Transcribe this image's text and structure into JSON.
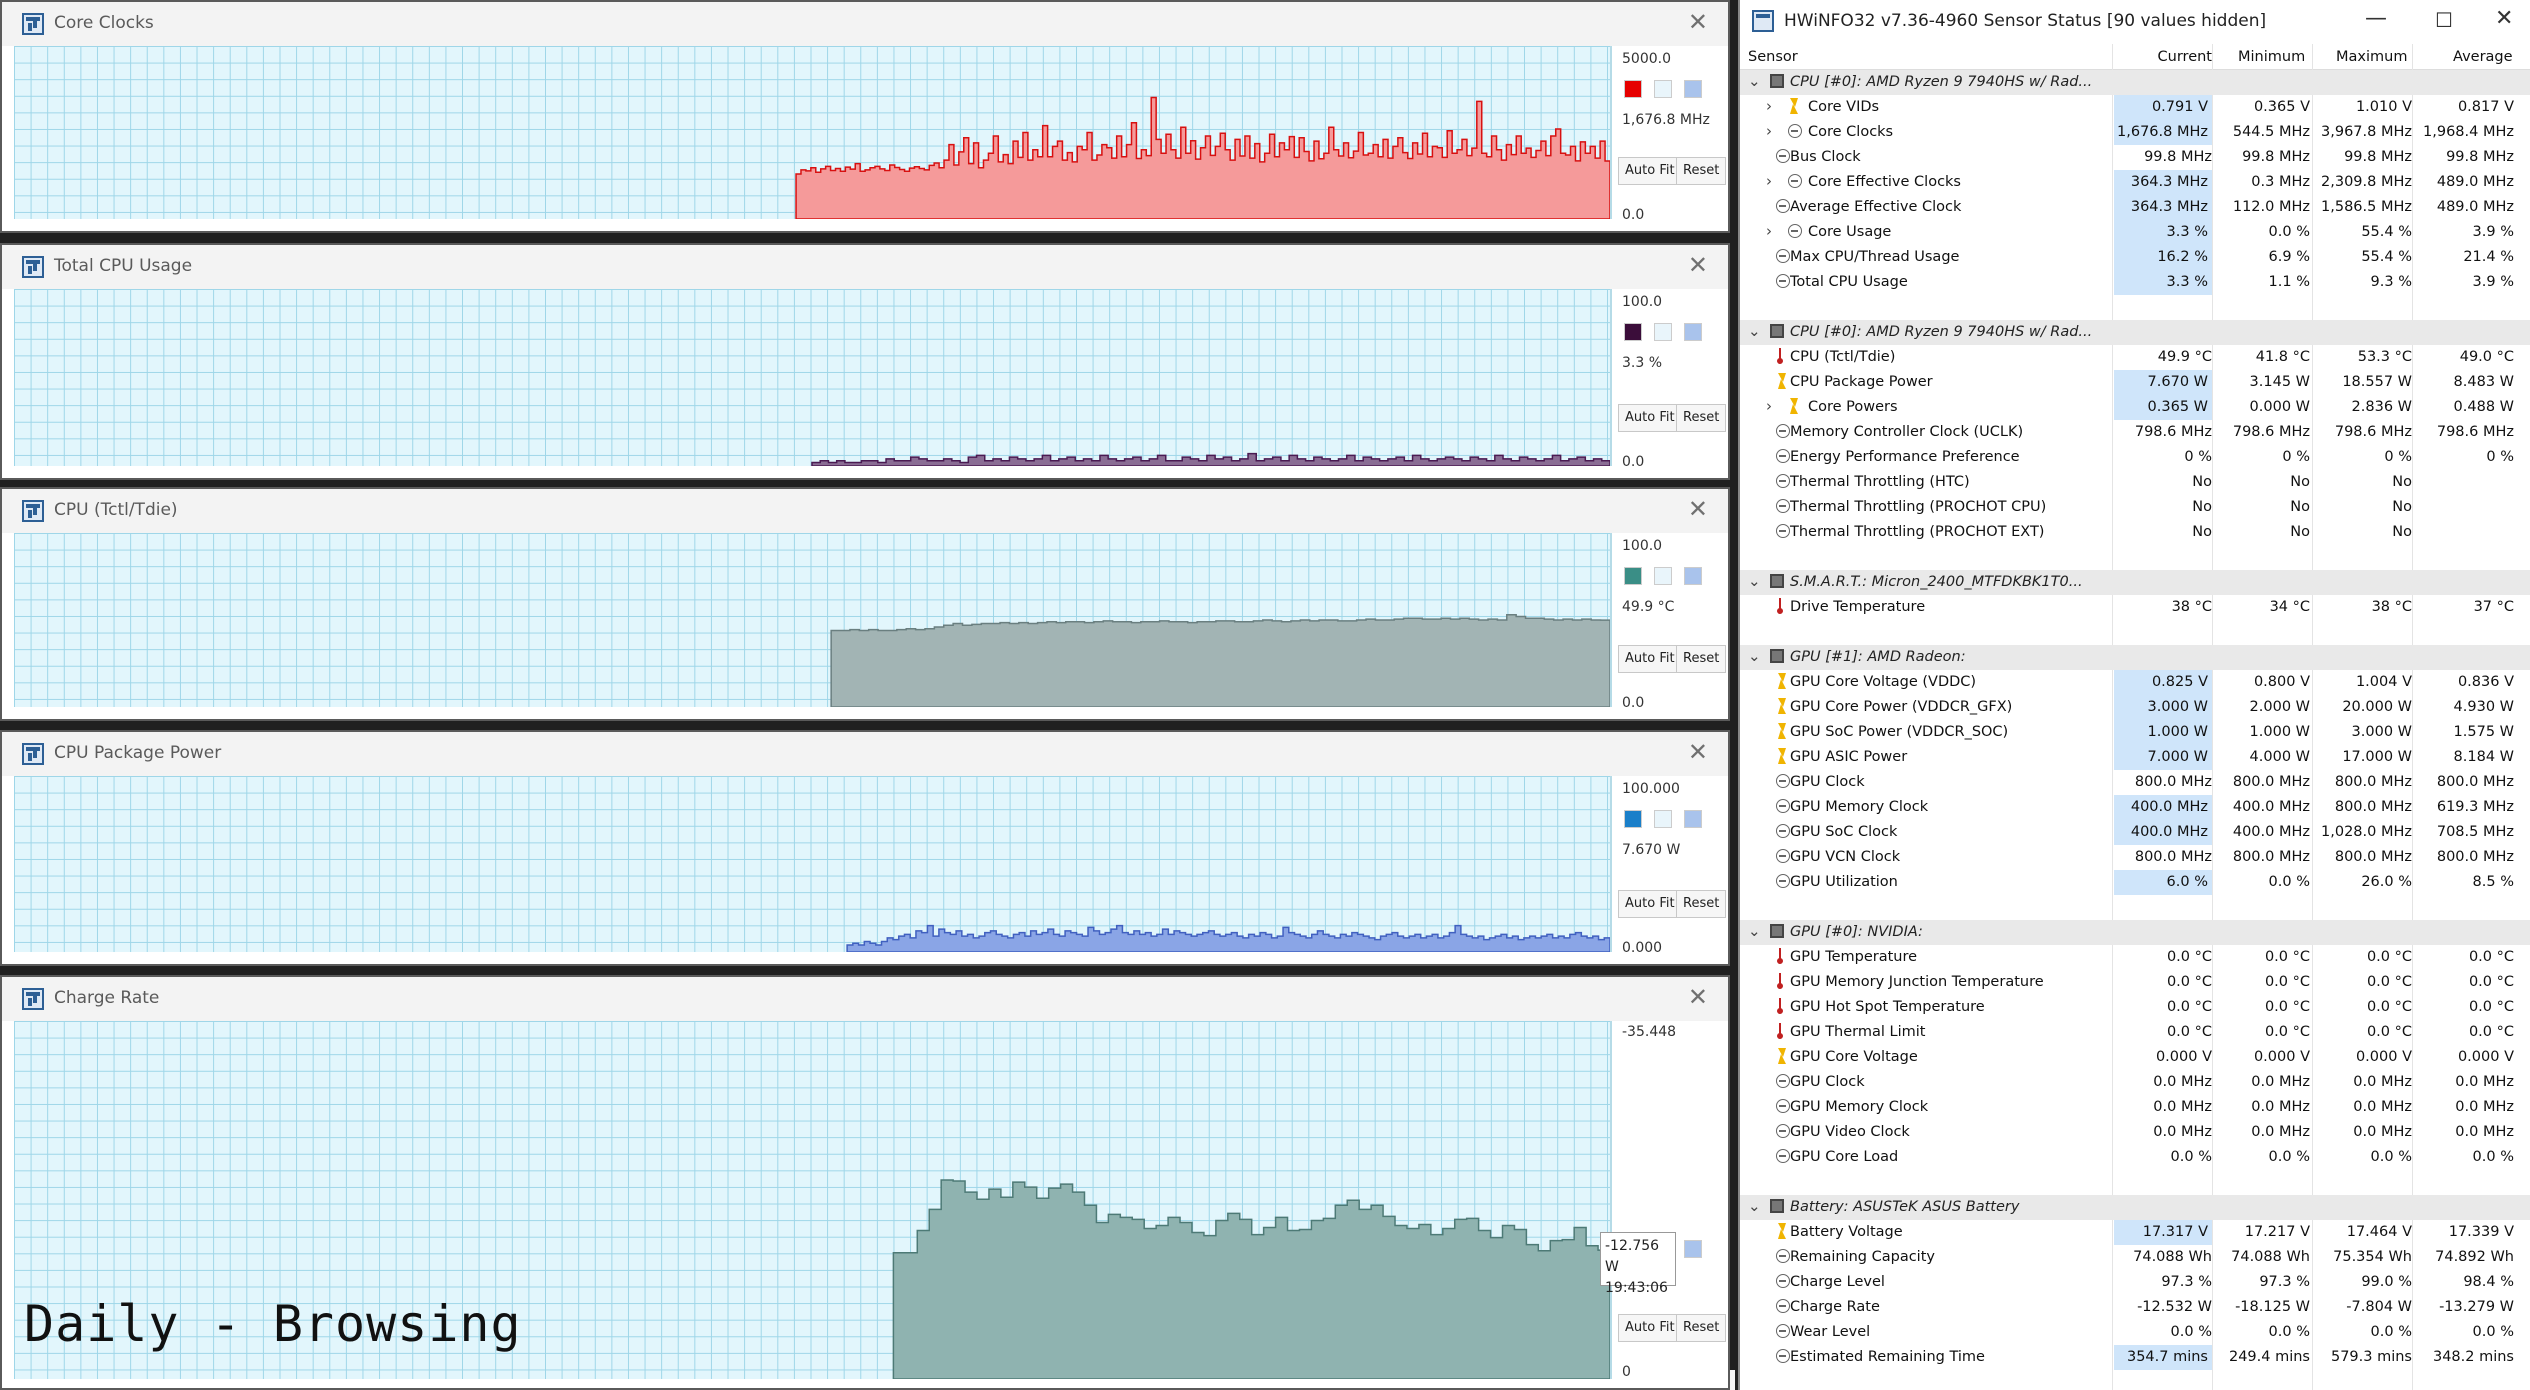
{
  "graphs": [
    {
      "title": "Core Clocks",
      "max": "5000.0",
      "min": "0.0",
      "current": "1,676.8 MHz",
      "color": "#e60000",
      "fill": "#f59a9a",
      "stroke": "#d81010",
      "series_max": 5000,
      "series": [
        1300,
        1420,
        1390,
        1480,
        1350,
        1450,
        1520,
        1400,
        1460,
        1380,
        1500,
        1440,
        1600,
        1380,
        1420,
        1480,
        1520,
        1450,
        1400,
        1560,
        1490,
        1430,
        1380,
        1470,
        1510,
        1460,
        1420,
        1550,
        1620,
        1480,
        1700,
        2150,
        1560,
        1940,
        2350,
        1600,
        2200,
        1480,
        1700,
        1900,
        2400,
        1650,
        1860,
        1600,
        2250,
        1780,
        2500,
        1700,
        2000,
        1800,
        2700,
        1800,
        2100,
        2250,
        1700,
        1920,
        1650,
        2100,
        2000,
        2500,
        1700,
        1850,
        2150,
        2060,
        1760,
        2400,
        1800,
        2150,
        2780,
        1750,
        2000,
        1830,
        3510,
        2300,
        1900,
        2450,
        2000,
        1760,
        2650,
        1900,
        2260,
        1730,
        2060,
        2400,
        1840,
        2100,
        2480,
        2000,
        1700,
        2300,
        1820,
        2400,
        1760,
        2180,
        1650,
        1900,
        2450,
        1800,
        2200,
        2000,
        2380,
        1780,
        2350,
        1950,
        1680,
        2250,
        1740,
        1900,
        2650,
        2000,
        1820,
        2200,
        1770,
        1960,
        2500,
        1850,
        1900,
        2150,
        1800,
        2300,
        1760,
        2100,
        2350,
        1920,
        1750,
        2200,
        1880,
        2480,
        1800,
        2100,
        2060,
        1780,
        2550,
        1900,
        2000,
        2300,
        1830,
        2050,
        3400,
        1900,
        1800,
        2400,
        2000,
        1700,
        2150,
        1860,
        2400,
        1900,
        2050,
        1780,
        1980,
        2250,
        1830,
        2400,
        2600,
        1900,
        1850,
        2100,
        1680,
        2230,
        1900,
        2100,
        1760,
        2250,
        1676
      ],
      "start_frac": 0.49,
      "hist_start_at": 0
    },
    {
      "title": "Total CPU Usage",
      "max": "100.0",
      "min": "0.0",
      "current": "3.3 %",
      "color": "#3b0d3a",
      "fill": "#8a6d94",
      "stroke": "#4a1a52",
      "series_max": 100,
      "series": [
        2,
        3,
        2,
        3,
        2,
        2,
        3,
        3,
        2,
        4,
        3,
        3,
        5,
        4,
        3,
        3,
        4,
        3,
        2,
        5,
        6,
        3,
        4,
        3,
        5,
        4,
        3,
        4,
        6,
        3,
        4,
        5,
        3,
        4,
        3,
        6,
        4,
        3,
        4,
        5,
        3,
        4,
        6,
        3,
        3,
        5,
        4,
        3,
        6,
        4,
        5,
        3,
        4,
        7,
        3,
        4,
        5,
        3,
        6,
        4,
        3,
        5,
        4,
        3,
        4,
        6,
        3,
        5,
        4,
        3,
        4,
        5,
        3,
        6,
        4,
        3,
        4,
        5,
        4,
        3,
        5,
        4,
        3,
        6,
        4,
        3,
        5,
        4,
        3,
        4,
        6,
        3,
        4,
        5,
        3,
        4,
        3
      ],
      "start_frac": 0.5,
      "hist_start_at": 0
    },
    {
      "title": "CPU (Tctl/Tdie)",
      "max": "100.0",
      "min": "0.0",
      "current": "49.9 °C",
      "color": "#3a8e86",
      "fill": "#a2b4b4",
      "stroke": "#6a7f80",
      "series_max": 100,
      "series": [
        44,
        44,
        44.5,
        44,
        44.5,
        44,
        44,
        44.5,
        45,
        44.5,
        45,
        46,
        47,
        48,
        47,
        47.5,
        48,
        48,
        48.5,
        48,
        48.5,
        48,
        48.5,
        49,
        48.5,
        49,
        49,
        48.5,
        49,
        49.5,
        49,
        49,
        48.5,
        49,
        49,
        49.5,
        49,
        49,
        48.5,
        49,
        49,
        49.5,
        49.5,
        49,
        49,
        49.5,
        50,
        49.5,
        49,
        49.5,
        50,
        49.5,
        50,
        50,
        49.5,
        49.5,
        50,
        50.5,
        50,
        50,
        50.5,
        51,
        51,
        50.5,
        50.5,
        51,
        50.5,
        51,
        50.5,
        50,
        50.5,
        50,
        53,
        52,
        51,
        51,
        50.5,
        50,
        50.5,
        50,
        50.5,
        50,
        49.9
      ],
      "start_frac": 0.512,
      "hist_start_at": 0
    },
    {
      "title": "CPU Package Power",
      "max": "100.000",
      "min": "0.000",
      "current": "7.670 W",
      "color": "#1a7fc9",
      "fill": "#8aa5e6",
      "stroke": "#4060c0",
      "series_max": 100,
      "series": [
        4,
        5,
        4,
        6,
        5,
        4,
        6,
        8,
        7,
        9,
        10,
        8,
        12,
        11,
        15,
        9,
        13,
        11,
        10,
        12,
        9,
        10,
        8,
        9,
        11,
        12,
        10,
        9,
        8,
        10,
        11,
        9,
        12,
        10,
        11,
        13,
        10,
        9,
        12,
        11,
        10,
        9,
        14,
        12,
        10,
        11,
        13,
        15,
        11,
        10,
        12,
        10,
        11,
        9,
        10,
        13,
        10,
        12,
        11,
        10,
        9,
        10,
        11,
        12,
        10,
        9,
        10,
        11,
        9,
        8,
        10,
        9,
        11,
        10,
        8,
        9,
        14,
        11,
        10,
        9,
        8,
        10,
        12,
        10,
        9,
        8,
        10,
        9,
        11,
        10,
        9,
        8,
        7,
        9,
        10,
        11,
        9,
        8,
        9,
        10,
        8,
        9,
        10,
        8,
        9,
        11,
        15,
        10,
        9,
        8,
        9,
        7,
        8,
        9,
        10,
        8,
        9,
        7,
        8,
        9,
        8,
        9,
        10,
        8,
        9,
        8,
        10,
        11,
        9,
        8,
        9,
        7,
        8
      ],
      "start_frac": 0.522,
      "hist_start_at": 0
    },
    {
      "title": "Charge Rate",
      "max": "-35.448",
      "min": "0",
      "current": "-12.756 W",
      "color": "#1a8a80",
      "fill": "#8fb3b0",
      "stroke": "#4d7a76",
      "series_max": 35.448,
      "series": [
        12.5,
        12.5,
        14.7,
        16.8,
        19.7,
        19.6,
        18.5,
        17.8,
        18.8,
        18.0,
        19.5,
        19.0,
        17.9,
        18.9,
        19.3,
        18.5,
        17.2,
        15.5,
        16.3,
        16.0,
        15.8,
        14.9,
        15.2,
        16.0,
        15.5,
        14.5,
        14.2,
        15.7,
        16.4,
        15.8,
        14.3,
        15.0,
        16.0,
        14.7,
        14.8,
        15.7,
        15.9,
        17.2,
        17.7,
        16.8,
        17.2,
        16.1,
        15.2,
        14.9,
        15.3,
        14.3,
        14.9,
        15.8,
        15.9,
        14.7,
        14.0,
        15.2,
        14.8,
        13.3,
        12.7,
        13.7,
        13.8,
        15.0,
        13.2,
        12.756
      ],
      "start_frac": 0.551,
      "hist_start_at": 0
    }
  ],
  "graph_buttons": {
    "autofit": "Auto Fit",
    "reset": "Reset"
  },
  "overlay_text": "Daily - Browsing",
  "tooltip": {
    "value": "-12.756 W",
    "time": "19:43:06"
  },
  "hwinfo": {
    "title": "HWiNFO32 v7.36-4960 Sensor Status [90 values hidden]",
    "columns": [
      "Sensor",
      "Current",
      "Minimum",
      "Maximum",
      "Average"
    ],
    "rows": [
      {
        "t": "grp",
        "name": "CPU [#0]: AMD Ryzen 9 7940HS w/ Rad..."
      },
      {
        "t": "row",
        "ind": 2,
        "exp": true,
        "icon": "volt",
        "name": "Core VIDs",
        "cur": "0.791 V",
        "min": "0.365 V",
        "max": "1.010 V",
        "avg": "0.817 V",
        "hl": true
      },
      {
        "t": "row",
        "ind": 2,
        "exp": true,
        "icon": "clk",
        "name": "Core Clocks",
        "cur": "1,676.8 MHz",
        "min": "544.5 MHz",
        "max": "3,967.8 MHz",
        "avg": "1,968.4 MHz",
        "hl": true
      },
      {
        "t": "row",
        "ind": 1,
        "icon": "clk",
        "name": "Bus Clock",
        "cur": "99.8 MHz",
        "min": "99.8 MHz",
        "max": "99.8 MHz",
        "avg": "99.8 MHz"
      },
      {
        "t": "row",
        "ind": 2,
        "exp": true,
        "icon": "clk",
        "name": "Core Effective Clocks",
        "cur": "364.3 MHz",
        "min": "0.3 MHz",
        "max": "2,309.8 MHz",
        "avg": "489.0 MHz",
        "hl": true
      },
      {
        "t": "row",
        "ind": 1,
        "icon": "clk",
        "name": "Average Effective Clock",
        "cur": "364.3 MHz",
        "min": "112.0 MHz",
        "max": "1,586.5 MHz",
        "avg": "489.0 MHz",
        "hl": true
      },
      {
        "t": "row",
        "ind": 2,
        "exp": true,
        "icon": "clk",
        "name": "Core Usage",
        "cur": "3.3 %",
        "min": "0.0 %",
        "max": "55.4 %",
        "avg": "3.9 %",
        "hl": true
      },
      {
        "t": "row",
        "ind": 1,
        "icon": "clk",
        "name": "Max CPU/Thread Usage",
        "cur": "16.2 %",
        "min": "6.9 %",
        "max": "55.4 %",
        "avg": "21.4 %",
        "hl": true
      },
      {
        "t": "row",
        "ind": 1,
        "icon": "clk",
        "name": "Total CPU Usage",
        "cur": "3.3 %",
        "min": "1.1 %",
        "max": "9.3 %",
        "avg": "3.9 %",
        "hl": true
      },
      {
        "t": "spc"
      },
      {
        "t": "grp",
        "name": "CPU [#0]: AMD Ryzen 9 7940HS w/ Rad..."
      },
      {
        "t": "row",
        "ind": 1,
        "icon": "therm",
        "name": "CPU (Tctl/Tdie)",
        "cur": "49.9 °C",
        "min": "41.8 °C",
        "max": "53.3 °C",
        "avg": "49.0 °C"
      },
      {
        "t": "row",
        "ind": 1,
        "icon": "volt",
        "name": "CPU Package Power",
        "cur": "7.670 W",
        "min": "3.145 W",
        "max": "18.557 W",
        "avg": "8.483 W",
        "hl": true
      },
      {
        "t": "row",
        "ind": 2,
        "exp": true,
        "icon": "volt",
        "name": "Core Powers",
        "cur": "0.365 W",
        "min": "0.000 W",
        "max": "2.836 W",
        "avg": "0.488 W",
        "hl": true
      },
      {
        "t": "row",
        "ind": 1,
        "icon": "clk",
        "name": "Memory Controller Clock (UCLK)",
        "cur": "798.6 MHz",
        "min": "798.6 MHz",
        "max": "798.6 MHz",
        "avg": "798.6 MHz"
      },
      {
        "t": "row",
        "ind": 1,
        "icon": "clk",
        "name": "Energy Performance Preference",
        "cur": "0 %",
        "min": "0 %",
        "max": "0 %",
        "avg": "0 %"
      },
      {
        "t": "row",
        "ind": 1,
        "icon": "clk",
        "name": "Thermal Throttling (HTC)",
        "cur": "No",
        "min": "No",
        "max": "No",
        "avg": ""
      },
      {
        "t": "row",
        "ind": 1,
        "icon": "clk",
        "name": "Thermal Throttling (PROCHOT CPU)",
        "cur": "No",
        "min": "No",
        "max": "No",
        "avg": ""
      },
      {
        "t": "row",
        "ind": 1,
        "icon": "clk",
        "name": "Thermal Throttling (PROCHOT EXT)",
        "cur": "No",
        "min": "No",
        "max": "No",
        "avg": ""
      },
      {
        "t": "spc"
      },
      {
        "t": "grp",
        "name": "S.M.A.R.T.: Micron_2400_MTFDKBK1T0..."
      },
      {
        "t": "row",
        "ind": 1,
        "icon": "therm",
        "name": "Drive Temperature",
        "cur": "38 °C",
        "min": "34 °C",
        "max": "38 °C",
        "avg": "37 °C"
      },
      {
        "t": "spc"
      },
      {
        "t": "grp",
        "name": "GPU [#1]: AMD Radeon:"
      },
      {
        "t": "row",
        "ind": 1,
        "icon": "volt",
        "name": "GPU Core Voltage (VDDC)",
        "cur": "0.825 V",
        "min": "0.800 V",
        "max": "1.004 V",
        "avg": "0.836 V",
        "hl": true
      },
      {
        "t": "row",
        "ind": 1,
        "icon": "volt",
        "name": "GPU Core Power (VDDCR_GFX)",
        "cur": "3.000 W",
        "min": "2.000 W",
        "max": "20.000 W",
        "avg": "4.930 W",
        "hl": true
      },
      {
        "t": "row",
        "ind": 1,
        "icon": "volt",
        "name": "GPU SoC Power (VDDCR_SOC)",
        "cur": "1.000 W",
        "min": "1.000 W",
        "max": "3.000 W",
        "avg": "1.575 W",
        "hl": true
      },
      {
        "t": "row",
        "ind": 1,
        "icon": "volt",
        "name": "GPU ASIC Power",
        "cur": "7.000 W",
        "min": "4.000 W",
        "max": "17.000 W",
        "avg": "8.184 W",
        "hl": true
      },
      {
        "t": "row",
        "ind": 1,
        "icon": "clk",
        "name": "GPU Clock",
        "cur": "800.0 MHz",
        "min": "800.0 MHz",
        "max": "800.0 MHz",
        "avg": "800.0 MHz"
      },
      {
        "t": "row",
        "ind": 1,
        "icon": "clk",
        "name": "GPU Memory Clock",
        "cur": "400.0 MHz",
        "min": "400.0 MHz",
        "max": "800.0 MHz",
        "avg": "619.3 MHz",
        "hl": true
      },
      {
        "t": "row",
        "ind": 1,
        "icon": "clk",
        "name": "GPU SoC Clock",
        "cur": "400.0 MHz",
        "min": "400.0 MHz",
        "max": "1,028.0 MHz",
        "avg": "708.5 MHz",
        "hl": true
      },
      {
        "t": "row",
        "ind": 1,
        "icon": "clk",
        "name": "GPU VCN Clock",
        "cur": "800.0 MHz",
        "min": "800.0 MHz",
        "max": "800.0 MHz",
        "avg": "800.0 MHz"
      },
      {
        "t": "row",
        "ind": 1,
        "icon": "clk",
        "name": "GPU Utilization",
        "cur": "6.0 %",
        "min": "0.0 %",
        "max": "26.0 %",
        "avg": "8.5 %",
        "hl": true
      },
      {
        "t": "spc"
      },
      {
        "t": "grp",
        "name": "GPU [#0]: NVIDIA:"
      },
      {
        "t": "row",
        "ind": 1,
        "icon": "therm",
        "name": "GPU Temperature",
        "cur": "0.0 °C",
        "min": "0.0 °C",
        "max": "0.0 °C",
        "avg": "0.0 °C"
      },
      {
        "t": "row",
        "ind": 1,
        "icon": "therm",
        "name": "GPU Memory Junction Temperature",
        "cur": "0.0 °C",
        "min": "0.0 °C",
        "max": "0.0 °C",
        "avg": "0.0 °C"
      },
      {
        "t": "row",
        "ind": 1,
        "icon": "therm",
        "name": "GPU Hot Spot Temperature",
        "cur": "0.0 °C",
        "min": "0.0 °C",
        "max": "0.0 °C",
        "avg": "0.0 °C"
      },
      {
        "t": "row",
        "ind": 1,
        "icon": "therm",
        "name": "GPU Thermal Limit",
        "cur": "0.0 °C",
        "min": "0.0 °C",
        "max": "0.0 °C",
        "avg": "0.0 °C"
      },
      {
        "t": "row",
        "ind": 1,
        "icon": "volt",
        "name": "GPU Core Voltage",
        "cur": "0.000 V",
        "min": "0.000 V",
        "max": "0.000 V",
        "avg": "0.000 V"
      },
      {
        "t": "row",
        "ind": 1,
        "icon": "clk",
        "name": "GPU Clock",
        "cur": "0.0 MHz",
        "min": "0.0 MHz",
        "max": "0.0 MHz",
        "avg": "0.0 MHz"
      },
      {
        "t": "row",
        "ind": 1,
        "icon": "clk",
        "name": "GPU Memory Clock",
        "cur": "0.0 MHz",
        "min": "0.0 MHz",
        "max": "0.0 MHz",
        "avg": "0.0 MHz"
      },
      {
        "t": "row",
        "ind": 1,
        "icon": "clk",
        "name": "GPU Video Clock",
        "cur": "0.0 MHz",
        "min": "0.0 MHz",
        "max": "0.0 MHz",
        "avg": "0.0 MHz"
      },
      {
        "t": "row",
        "ind": 1,
        "icon": "clk",
        "name": "GPU Core Load",
        "cur": "0.0 %",
        "min": "0.0 %",
        "max": "0.0 %",
        "avg": "0.0 %"
      },
      {
        "t": "spc"
      },
      {
        "t": "grp",
        "name": "Battery: ASUSTeK ASUS Battery"
      },
      {
        "t": "row",
        "ind": 1,
        "icon": "volt",
        "name": "Battery Voltage",
        "cur": "17.317 V",
        "min": "17.217 V",
        "max": "17.464 V",
        "avg": "17.339 V",
        "hl": true
      },
      {
        "t": "row",
        "ind": 1,
        "icon": "clk",
        "name": "Remaining Capacity",
        "cur": "74.088 Wh",
        "min": "74.088 Wh",
        "max": "75.354 Wh",
        "avg": "74.892 Wh"
      },
      {
        "t": "row",
        "ind": 1,
        "icon": "clk",
        "name": "Charge Level",
        "cur": "97.3 %",
        "min": "97.3 %",
        "max": "99.0 %",
        "avg": "98.4 %"
      },
      {
        "t": "row",
        "ind": 1,
        "icon": "clk",
        "name": "Charge Rate",
        "cur": "-12.532 W",
        "min": "-18.125 W",
        "max": "-7.804 W",
        "avg": "-13.279 W"
      },
      {
        "t": "row",
        "ind": 1,
        "icon": "clk",
        "name": "Wear Level",
        "cur": "0.0 %",
        "min": "0.0 %",
        "max": "0.0 %",
        "avg": "0.0 %"
      },
      {
        "t": "row",
        "ind": 1,
        "icon": "clk",
        "name": "Estimated Remaining Time",
        "cur": "354.7 mins",
        "min": "249.4 mins",
        "max": "579.3 mins",
        "avg": "348.2 mins",
        "hl": true
      }
    ]
  }
}
